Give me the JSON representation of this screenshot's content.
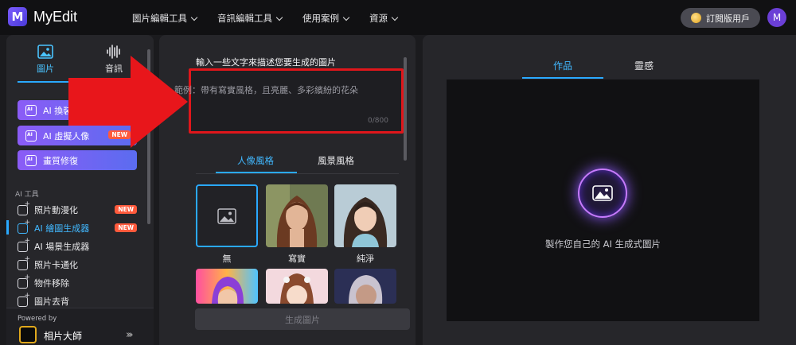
{
  "header": {
    "logo_letter": "M",
    "app_name": "MyEdit",
    "nav": [
      "圖片編輯工具",
      "音訊編輯工具",
      "使用案例",
      "資源"
    ],
    "subscribe_label": "訂閱版用戶",
    "avatar_letter": "M"
  },
  "sidebar": {
    "tabs": [
      "圖片",
      "音訊"
    ],
    "feature_buttons": [
      {
        "label": "AI 換裝",
        "badge": ""
      },
      {
        "label": "AI 虛擬人像",
        "badge": "NEW"
      },
      {
        "label": "畫質修復",
        "badge": ""
      }
    ],
    "section_title": "AI 工具",
    "tools": [
      {
        "label": "照片動漫化",
        "badge": "NEW"
      },
      {
        "label": "AI 繪圖生成器",
        "badge": "NEW"
      },
      {
        "label": "AI 場景生成器",
        "badge": ""
      },
      {
        "label": "照片卡通化",
        "badge": ""
      },
      {
        "label": "物件移除",
        "badge": ""
      },
      {
        "label": "圖片去背",
        "badge": ""
      }
    ],
    "powered_by": "Powered by",
    "powered_name": "相片大師",
    "powered_arrow": "›››"
  },
  "generator": {
    "prompt_label": "輸入一些文字來描述您要生成的圖片",
    "placeholder": "範例：帶有寫實風格，且亮麗、多彩繽紛的花朵",
    "counter": "0/800",
    "style_tabs": [
      "人像風格",
      "風景風格"
    ],
    "styles": [
      "無",
      "寫實",
      "純淨"
    ],
    "generate_label": "生成圖片"
  },
  "output": {
    "tabs": [
      "作品",
      "靈感"
    ],
    "empty_text": "製作您自己的 AI 生成式圖片"
  },
  "colors": {
    "accent": "#2aa9ff",
    "highlight_box": "#e0161b",
    "arrow": "#e8161b",
    "badge": "#ff5a3c"
  }
}
